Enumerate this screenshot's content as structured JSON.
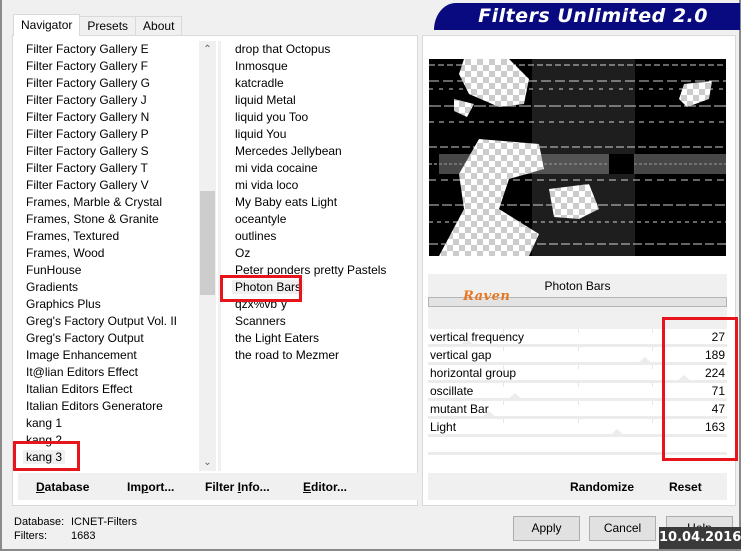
{
  "app": {
    "title": "Filters Unlimited 2.0"
  },
  "tabs": [
    {
      "label": "Navigator",
      "active": true
    },
    {
      "label": "Presets",
      "active": false
    },
    {
      "label": "About",
      "active": false
    }
  ],
  "categories": {
    "items": [
      "Filter Factory Gallery E",
      "Filter Factory Gallery F",
      "Filter Factory Gallery G",
      "Filter Factory Gallery J",
      "Filter Factory Gallery N",
      "Filter Factory Gallery P",
      "Filter Factory Gallery S",
      "Filter Factory Gallery T",
      "Filter Factory Gallery V",
      "Frames, Marble & Crystal",
      "Frames, Stone & Granite",
      "Frames, Textured",
      "Frames, Wood",
      "FunHouse",
      "Gradients",
      "Graphics Plus",
      "Greg's Factory Output Vol. II",
      "Greg's Factory Output",
      "Image Enhancement",
      "It@lian Editors Effect",
      "Italian Editors Effect",
      "Italian Editors Generatore",
      "kang 1",
      "kang 2",
      "kang 3"
    ],
    "selected": "kang 3"
  },
  "filters": {
    "items": [
      "drop that Octopus",
      "Inmosque",
      "katcradle",
      "liquid Metal",
      "liquid you Too",
      "liquid You",
      "Mercedes Jellybean",
      "mi vida cocaine",
      "mi vida loco",
      "My Baby eats Light",
      "oceantyle",
      "outlines",
      "Oz",
      "Peter ponders pretty Pastels",
      "Photon Bars",
      "qzx%vb`y",
      "Scanners",
      "the Light Eaters",
      "the road to Mezmer"
    ],
    "selected": "Photon Bars"
  },
  "left_buttons": {
    "database": {
      "pre": "",
      "u": "D",
      "post": "atabase"
    },
    "import": {
      "pre": "Im",
      "u": "p",
      "post": "ort..."
    },
    "filter_info": {
      "pre": "Filter ",
      "u": "I",
      "post": "nfo..."
    },
    "editor": {
      "pre": "",
      "u": "E",
      "post": "ditor..."
    }
  },
  "filter_panel": {
    "title": "Photon Bars",
    "author_logo": "Raven",
    "params": [
      {
        "name": "vertical frequency",
        "value": "27",
        "fraction": 0.106
      },
      {
        "name": "vertical gap",
        "value": "189",
        "fraction": 0.741
      },
      {
        "name": "horizontal group",
        "value": "224",
        "fraction": 0.878
      },
      {
        "name": "oscillate",
        "value": "71",
        "fraction": 0.278
      },
      {
        "name": "mutant Bar",
        "value": "47",
        "fraction": 0.184
      },
      {
        "name": "Light",
        "value": "163",
        "fraction": 0.639
      }
    ]
  },
  "right_buttons": {
    "randomize": "Randomize",
    "reset": "Reset"
  },
  "status": {
    "database_label": "Database:",
    "database_value": "ICNET-Filters",
    "filters_label": "Filters:",
    "filters_value": "1683"
  },
  "dialog_buttons": {
    "apply": "Apply",
    "cancel": "Cancel",
    "help": "Help"
  },
  "overlay": {
    "date": "10.04.2016"
  },
  "colors": {
    "banner": "#0a0a80",
    "highlight": "#e8141b",
    "raven": "#e87722"
  }
}
